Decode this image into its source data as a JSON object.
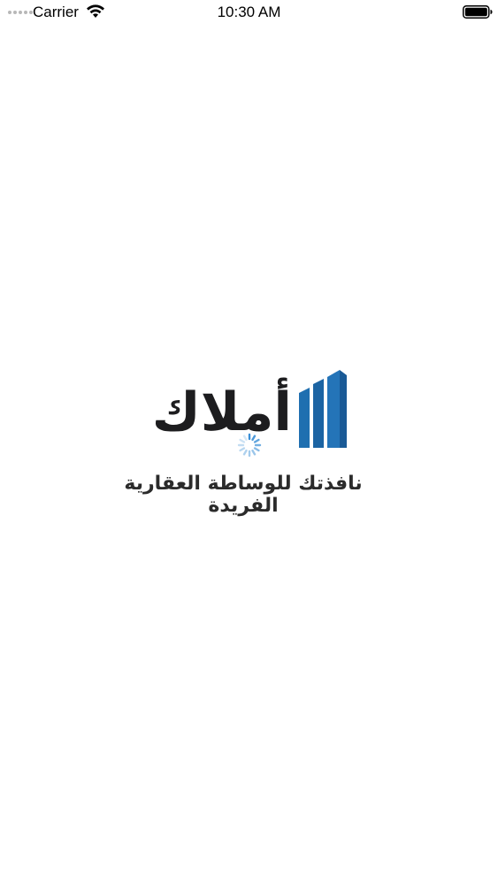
{
  "status_bar": {
    "carrier": "Carrier",
    "time": "10:30 AM",
    "icons": [
      "signal-icon",
      "wifi-icon",
      "battery-icon"
    ]
  },
  "splash": {
    "logo_text": "أملاك",
    "tagline": "نافذتك للوساطة العقارية الفريدة",
    "brand_color": "#1f6fb0",
    "text_color": "#1d1d1f",
    "loading": true
  }
}
